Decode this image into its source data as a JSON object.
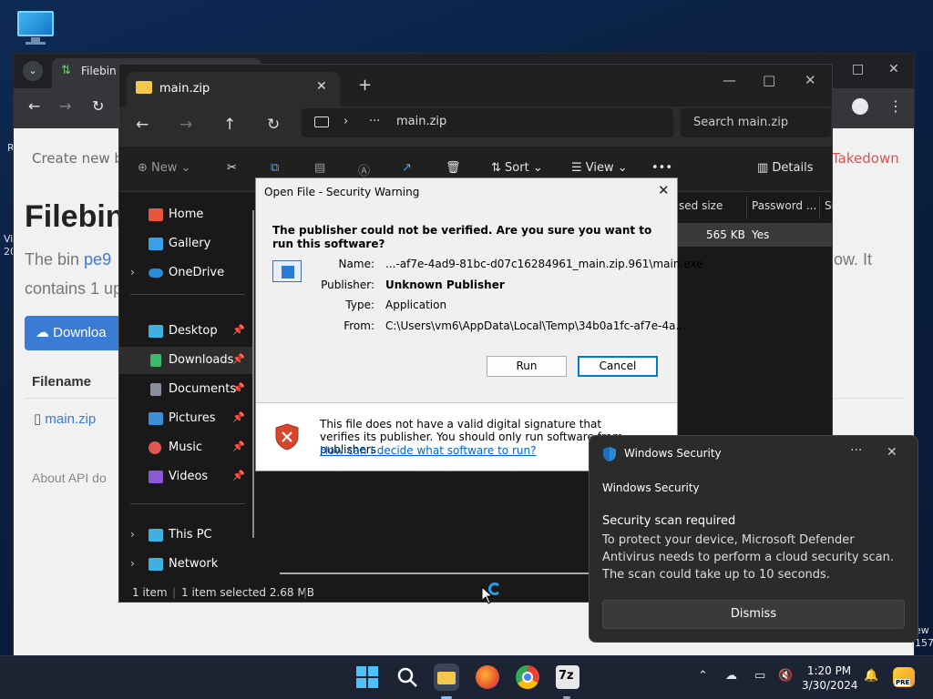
{
  "desktop": {
    "icon_name": "this-pc-icon",
    "edge_left_text": [
      "R",
      "Vi",
      "20"
    ],
    "edge_right_text": [
      "ew",
      "157"
    ]
  },
  "browser": {
    "tab_title": "Filebin |",
    "page": {
      "subnav": "Create new b",
      "takedown": "Takedown",
      "title": "Filebin",
      "bin_prefix": "The bin ",
      "bin_id": "pe9",
      "bin_tail": "ow. It",
      "contains": "contains 1 up",
      "download_label": "Downloa",
      "filename_header": "Filename",
      "file_link": "main.zip",
      "footer": "About   API do"
    }
  },
  "explorer": {
    "tab_title": "main.zip",
    "address_segment": "main.zip",
    "search_placeholder": "Search main.zip",
    "commands": {
      "new": "New",
      "sort": "Sort",
      "view": "View",
      "more": "•••",
      "details": "Details"
    },
    "sidebar": [
      {
        "label": "Home",
        "icon": "home-icon",
        "color": "#e8553e"
      },
      {
        "label": "Gallery",
        "icon": "gallery-icon",
        "color": "#3aa0e8"
      },
      {
        "label": "OneDrive",
        "icon": "onedrive-icon",
        "color": "#2b8ad8"
      },
      {
        "label": "Desktop",
        "icon": "desktop-icon",
        "color": "#3fb0e0"
      },
      {
        "label": "Downloads",
        "icon": "download-icon",
        "color": "#3dbb6a"
      },
      {
        "label": "Documents",
        "icon": "documents-icon",
        "color": "#8a8fa0"
      },
      {
        "label": "Pictures",
        "icon": "pictures-icon",
        "color": "#3a8fd8"
      },
      {
        "label": "Music",
        "icon": "music-icon",
        "color": "#e0574f"
      },
      {
        "label": "Videos",
        "icon": "videos-icon",
        "color": "#8a5ad8"
      },
      {
        "label": "This PC",
        "icon": "this-pc-icon",
        "color": "#3fb0e0"
      },
      {
        "label": "Network",
        "icon": "network-icon",
        "color": "#3fb0e0"
      }
    ],
    "columns": [
      "sed size",
      "Password ...",
      "Si"
    ],
    "row": {
      "size": "565 KB",
      "password": "Yes"
    },
    "status": {
      "count": "1 item",
      "selected": "1 item selected  2.68 MB"
    }
  },
  "dialog": {
    "title": "Open File - Security Warning",
    "question": "The publisher could not be verified.  Are you sure you want to run this software?",
    "fields": [
      {
        "label": "Name:",
        "value": "...-af7e-4ad9-81bc-d07c16284961_main.zip.961\\main.exe",
        "bold": false
      },
      {
        "label": "Publisher:",
        "value": "Unknown Publisher",
        "bold": true
      },
      {
        "label": "Type:",
        "value": "Application",
        "bold": false
      },
      {
        "label": "From:",
        "value": "C:\\Users\\vm6\\AppData\\Local\\Temp\\34b0a1fc-af7e-4a...",
        "bold": false
      }
    ],
    "run_label": "Run",
    "cancel_label": "Cancel",
    "warning": "This file does not have a valid digital signature that verifies its publisher.  You should only run software from publishers",
    "help_link": "How can I decide what software to run?"
  },
  "toast": {
    "app": "Windows Security",
    "more": "···",
    "subtitle": "Windows Security",
    "heading": "Security scan required",
    "body": "To protect your device, Microsoft Defender Antivirus needs to perform a cloud security scan. The scan could take up to 10 seconds.",
    "dismiss_label": "Dismiss"
  },
  "taskbar": {
    "time": "1:20 PM",
    "date": "3/30/2024",
    "apps": [
      "start-icon",
      "search-icon",
      "file-explorer-icon",
      "firefox-icon",
      "chrome-icon",
      "7zip-icon"
    ],
    "seven_zip_label": "7z",
    "copilot_badge": "PRE"
  }
}
